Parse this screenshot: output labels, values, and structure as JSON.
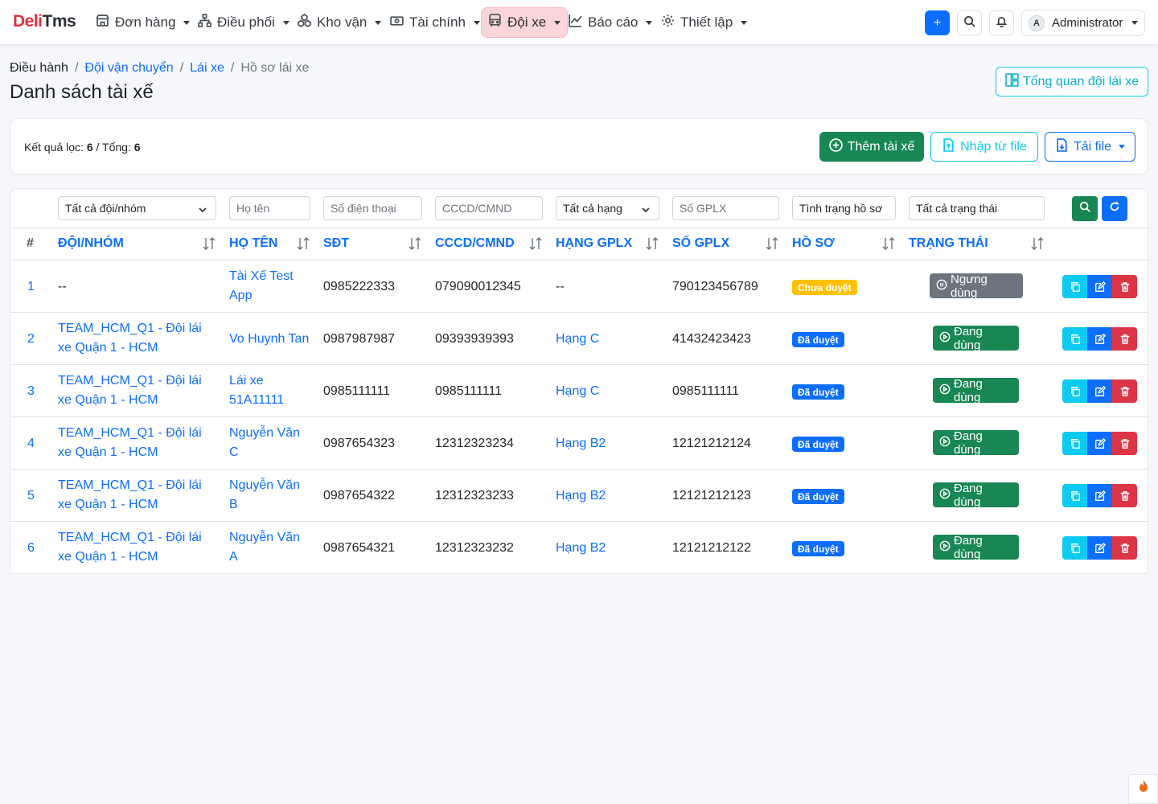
{
  "brand": {
    "part1": "Deli",
    "part2": "Tms"
  },
  "nav": {
    "items": [
      {
        "label": "Đơn hàng",
        "icon": "store-icon"
      },
      {
        "label": "Điều phối",
        "icon": "network-icon"
      },
      {
        "label": "Kho vận",
        "icon": "boxes-icon"
      },
      {
        "label": "Tài chính",
        "icon": "cash-icon"
      },
      {
        "label": "Đội xe",
        "icon": "bus-icon",
        "active": true
      },
      {
        "label": "Báo cáo",
        "icon": "chart-line-icon"
      },
      {
        "label": "Thiết lập",
        "icon": "gear-icon"
      }
    ],
    "plus_label": "+",
    "user": {
      "initial": "A",
      "name": "Administrator"
    }
  },
  "breadcrumb": {
    "b1": "Điều hành",
    "b2": "Đội vận chuyển",
    "b3": "Lái xe",
    "b4": "Hồ sơ lái xe",
    "sep": "/"
  },
  "page_title": "Danh sách tài xế",
  "overview_label": "Tổng quan đội lái xe",
  "summary": {
    "filtered_label": "Kết quả lọc:",
    "filtered": "6",
    "total_label": "/ Tổng:",
    "total": "6"
  },
  "actions": {
    "add": "Thêm tài xế",
    "import": "Nhập từ file",
    "download": "Tải file"
  },
  "filters": {
    "team": "Tất cả đội/nhóm",
    "name_ph": "Họ tên",
    "phone_ph": "Số điện thoại",
    "cccd_ph": "CCCD/CMND",
    "license_class": "Tất cả hạng",
    "license_no_ph": "Số GPLX",
    "profile_ph": "Tình trạng hồ sơ",
    "status_ph": "Tất cả trạng thái"
  },
  "columns": {
    "idx": "#",
    "team": "ĐỘI/NHÓM",
    "name": "HỌ TÊN",
    "phone": "SĐT",
    "cccd": "CCCD/CMND",
    "class": "HẠNG GPLX",
    "license": "SỐ GPLX",
    "profile": "HỒ SƠ",
    "status": "TRẠNG THÁI"
  },
  "rows": [
    {
      "idx": "1",
      "team1": "--",
      "team2": "",
      "name1": "Tài Xế Test",
      "name2": "App",
      "phone": "0985222333",
      "cccd": "079090012345",
      "class": "--",
      "license": "790123456789",
      "profile": "Chưa duyệt",
      "status": "Ngưng dùng"
    },
    {
      "idx": "2",
      "team1": "TEAM_HCM_Q1 - Đội lái",
      "team2": "xe Quận 1 - HCM",
      "name1": "Vo Huynh Tan",
      "name2": "",
      "phone": "0987987987",
      "cccd": "09393939393",
      "class": "Hạng C",
      "license": "41432423423",
      "profile": "Đã duyệt",
      "status": "Đang dùng"
    },
    {
      "idx": "3",
      "team1": "TEAM_HCM_Q1 - Đội lái",
      "team2": "xe Quận 1 - HCM",
      "name1": "Lái xe",
      "name2": "51A11111",
      "phone": "0985111111",
      "cccd": "0985111111",
      "class": "Hạng C",
      "license": "0985111111",
      "profile": "Đã duyệt",
      "status": "Đang dùng"
    },
    {
      "idx": "4",
      "team1": "TEAM_HCM_Q1 - Đội lái",
      "team2": "xe Quận 1 - HCM",
      "name1": "Nguyễn Văn",
      "name2": "C",
      "phone": "0987654323",
      "cccd": "12312323234",
      "class": "Hạng B2",
      "license": "12121212124",
      "profile": "Đã duyệt",
      "status": "Đang dùng"
    },
    {
      "idx": "5",
      "team1": "TEAM_HCM_Q1 - Đội lái",
      "team2": "xe Quận 1 - HCM",
      "name1": "Nguyễn Văn",
      "name2": "B",
      "phone": "0987654322",
      "cccd": "12312323233",
      "class": "Hạng B2",
      "license": "12121212123",
      "profile": "Đã duyệt",
      "status": "Đang dùng"
    },
    {
      "idx": "6",
      "team1": "TEAM_HCM_Q1 - Đội lái",
      "team2": "xe Quận 1 - HCM",
      "name1": "Nguyễn Văn",
      "name2": "A",
      "phone": "0987654321",
      "cccd": "12312323232",
      "class": "Hạng B2",
      "license": "12121212122",
      "profile": "Đã duyệt",
      "status": "Đang dùng"
    }
  ],
  "colors": {
    "primary": "#0d6efd",
    "success": "#198754",
    "info": "#0dcaf0",
    "danger": "#dc3545",
    "warning": "#ffc107",
    "secondary": "#6c757d",
    "brand_red": "#e0313d",
    "active_nav_bg": "#fbd6d8"
  }
}
